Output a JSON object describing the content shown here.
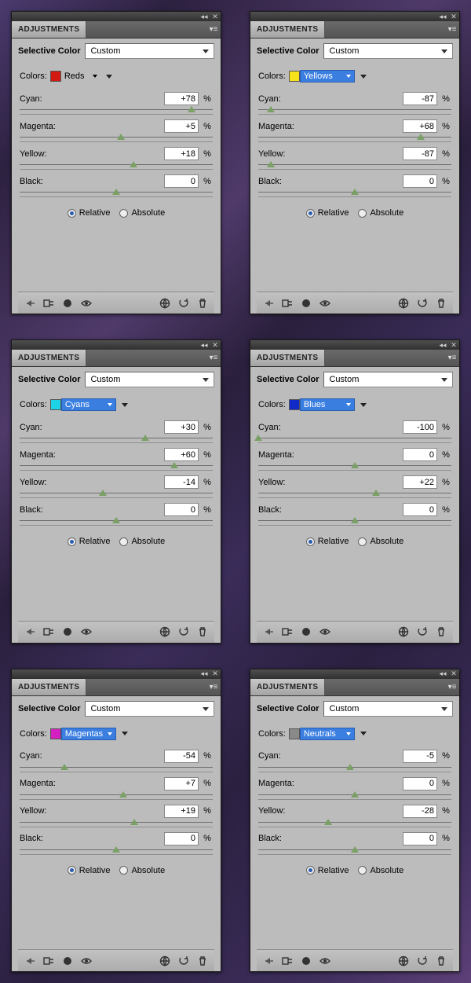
{
  "panels": [
    {
      "tab": "ADJUSTMENTS",
      "section": "Selective Color",
      "preset": "Custom",
      "colorsLabel": "Colors:",
      "colorName": "Reds",
      "swatch": "#d11b12",
      "dropStyle": "plain",
      "channels": [
        {
          "name": "Cyan:",
          "val": "+78"
        },
        {
          "name": "Magenta:",
          "val": "+5"
        },
        {
          "name": "Yellow:",
          "val": "+18"
        },
        {
          "name": "Black:",
          "val": "0"
        }
      ],
      "mode": {
        "relative": "Relative",
        "absolute": "Absolute",
        "selected": "relative"
      }
    },
    {
      "tab": "ADJUSTMENTS",
      "section": "Selective Color",
      "preset": "Custom",
      "colorsLabel": "Colors:",
      "colorName": "Yellows",
      "swatch": "#f6e21a",
      "dropStyle": "blue",
      "channels": [
        {
          "name": "Cyan:",
          "val": "-87"
        },
        {
          "name": "Magenta:",
          "val": "+68"
        },
        {
          "name": "Yellow:",
          "val": "-87"
        },
        {
          "name": "Black:",
          "val": "0"
        }
      ],
      "mode": {
        "relative": "Relative",
        "absolute": "Absolute",
        "selected": "relative"
      }
    },
    {
      "tab": "ADJUSTMENTS",
      "section": "Selective Color",
      "preset": "Custom",
      "colorsLabel": "Colors:",
      "colorName": "Cyans",
      "swatch": "#1fd3e6",
      "dropStyle": "blue",
      "channels": [
        {
          "name": "Cyan:",
          "val": "+30"
        },
        {
          "name": "Magenta:",
          "val": "+60"
        },
        {
          "name": "Yellow:",
          "val": "-14"
        },
        {
          "name": "Black:",
          "val": "0"
        }
      ],
      "mode": {
        "relative": "Relative",
        "absolute": "Absolute",
        "selected": "relative"
      }
    },
    {
      "tab": "ADJUSTMENTS",
      "section": "Selective Color",
      "preset": "Custom",
      "colorsLabel": "Colors:",
      "colorName": "Blues",
      "swatch": "#1029c8",
      "dropStyle": "blue",
      "channels": [
        {
          "name": "Cyan:",
          "val": "-100"
        },
        {
          "name": "Magenta:",
          "val": "0"
        },
        {
          "name": "Yellow:",
          "val": "+22"
        },
        {
          "name": "Black:",
          "val": "0"
        }
      ],
      "mode": {
        "relative": "Relative",
        "absolute": "Absolute",
        "selected": "relative"
      }
    },
    {
      "tab": "ADJUSTMENTS",
      "section": "Selective Color",
      "preset": "Custom",
      "colorsLabel": "Colors:",
      "colorName": "Magentas",
      "swatch": "#d61fc0",
      "dropStyle": "blue",
      "channels": [
        {
          "name": "Cyan:",
          "val": "-54"
        },
        {
          "name": "Magenta:",
          "val": "+7"
        },
        {
          "name": "Yellow:",
          "val": "+19"
        },
        {
          "name": "Black:",
          "val": "0"
        }
      ],
      "mode": {
        "relative": "Relative",
        "absolute": "Absolute",
        "selected": "relative"
      }
    },
    {
      "tab": "ADJUSTMENTS",
      "section": "Selective Color",
      "preset": "Custom",
      "colorsLabel": "Colors:",
      "colorName": "Neutrals",
      "swatch": "#8a8a8a",
      "dropStyle": "blue",
      "channels": [
        {
          "name": "Cyan:",
          "val": "-5"
        },
        {
          "name": "Magenta:",
          "val": "0"
        },
        {
          "name": "Yellow:",
          "val": "-28"
        },
        {
          "name": "Black:",
          "val": "0"
        }
      ],
      "mode": {
        "relative": "Relative",
        "absolute": "Absolute",
        "selected": "relative"
      }
    }
  ],
  "pct": "%"
}
